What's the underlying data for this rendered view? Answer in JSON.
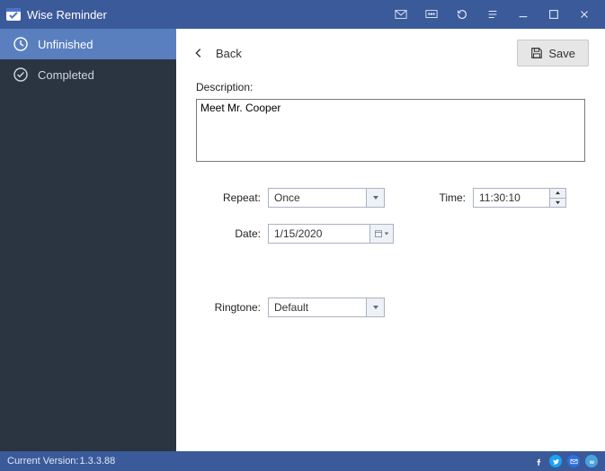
{
  "app": {
    "title": "Wise Reminder"
  },
  "sidebar": {
    "items": [
      {
        "label": "Unfinished"
      },
      {
        "label": "Completed"
      }
    ]
  },
  "toolbar": {
    "back_label": "Back",
    "save_label": "Save"
  },
  "form": {
    "description_label": "Description:",
    "description_value": "Meet Mr. Cooper ",
    "repeat_label": "Repeat:",
    "repeat_value": "Once",
    "time_label": "Time:",
    "time_value": "11:30:10",
    "date_label": "Date:",
    "date_value": "1/15/2020",
    "ringtone_label": "Ringtone:",
    "ringtone_value": "Default"
  },
  "footer": {
    "version_label": "Current Version:",
    "version_value": "1.3.3.88"
  },
  "colors": {
    "fb": "#3b5998",
    "tw": "#1da1f2",
    "mail": "#2e6fde",
    "w": "#4aa3df"
  }
}
